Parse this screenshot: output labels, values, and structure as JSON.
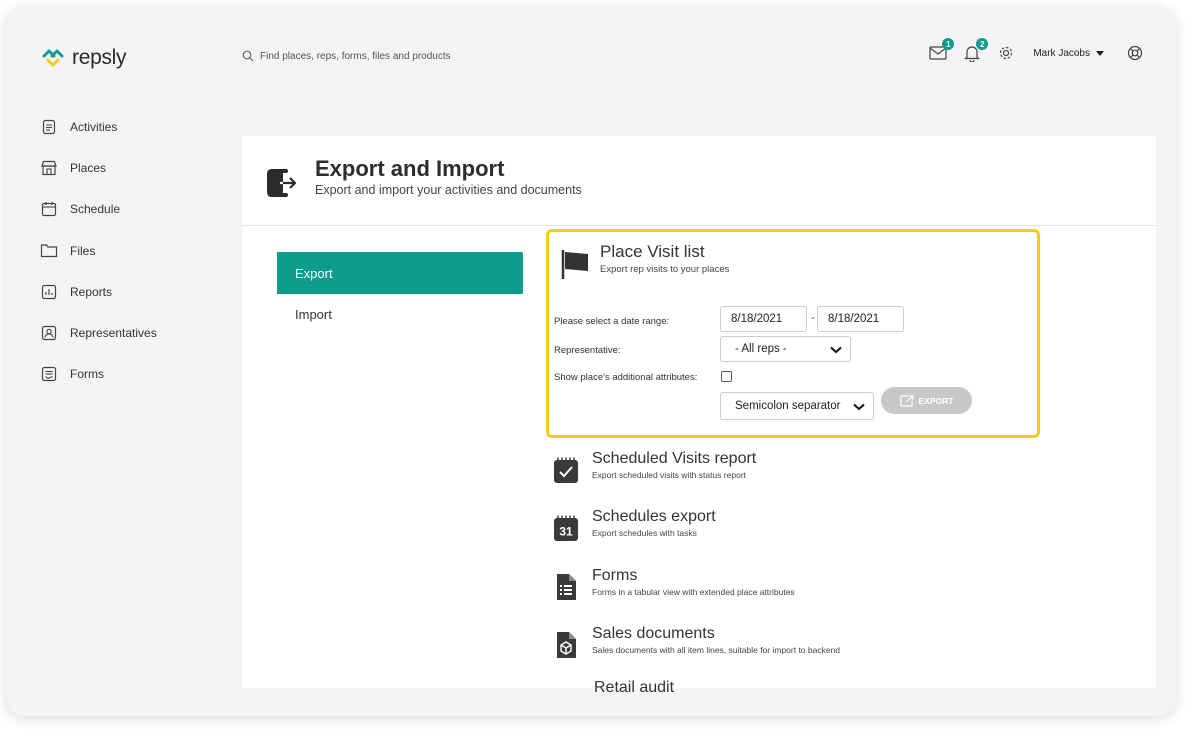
{
  "app": {
    "logo_text": "repsly",
    "brand_color": "#0e9c8d",
    "highlight_color": "#f5ca1a"
  },
  "search": {
    "placeholder": "Find places, reps, forms, files and products",
    "icon": "search-icon"
  },
  "header": {
    "mail_badge": "1",
    "notif_badge": "2",
    "user_name": "Mark Jacobs",
    "icons": [
      "mail-icon",
      "bell-icon",
      "gear-icon",
      "help-icon"
    ]
  },
  "sidebar": {
    "items": [
      {
        "label": "Activities",
        "icon": "clipboard-icon"
      },
      {
        "label": "Places",
        "icon": "store-icon"
      },
      {
        "label": "Schedule",
        "icon": "calendar-icon"
      },
      {
        "label": "Files",
        "icon": "folder-icon"
      },
      {
        "label": "Reports",
        "icon": "chart-icon"
      },
      {
        "label": "Representatives",
        "icon": "person-icon"
      },
      {
        "label": "Forms",
        "icon": "form-icon"
      }
    ]
  },
  "page": {
    "title": "Export and Import",
    "subtitle": "Export and import your activities and documents"
  },
  "tabs": {
    "export": "Export",
    "import": "Import"
  },
  "visit_list": {
    "title": "Place Visit list",
    "subtitle": "Export rep visits to your places",
    "date_label": "Please select a date range:",
    "date_from": "8/18/2021",
    "date_to": "8/18/2021",
    "date_sep": "-",
    "rep_label": "Representative:",
    "rep_value": "- All reps -",
    "attr_label": "Show place's additional attributes:",
    "attr_checked": false,
    "separator_value": "Semicolon separator",
    "export_label": "EXPORT"
  },
  "reports": [
    {
      "title": "Scheduled Visits report",
      "subtitle": "Export scheduled visits with status report",
      "icon": "calendar-check-icon"
    },
    {
      "title": "Schedules export",
      "subtitle": "Export schedules with tasks",
      "icon": "calendar-31-icon"
    },
    {
      "title": "Forms",
      "subtitle": "Forms in a tabular view with extended place attributes",
      "icon": "document-list-icon"
    },
    {
      "title": "Sales documents",
      "subtitle": "Sales documents with all item lines, suitable for import to backend",
      "icon": "document-box-icon"
    }
  ],
  "reports_partial": "Retail audit"
}
